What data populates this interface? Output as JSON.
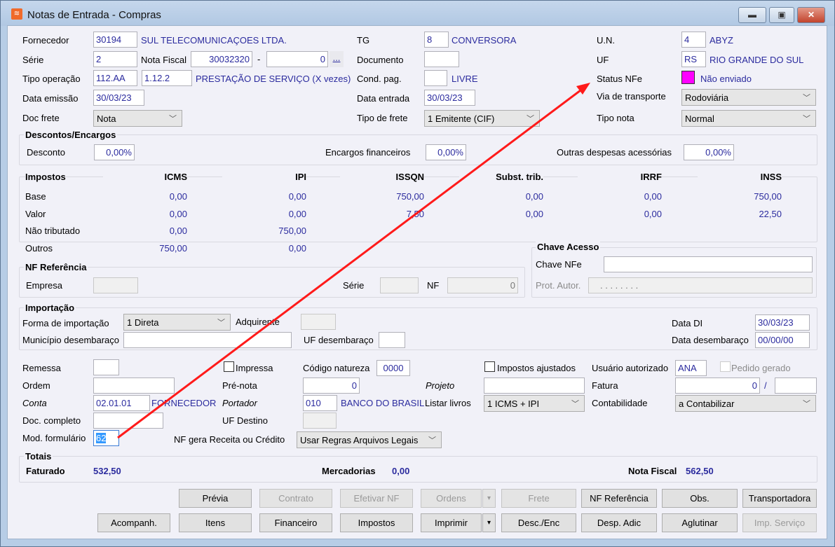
{
  "window": {
    "title": "Notas de Entrada - Compras",
    "minimize": "▬",
    "maximize": "▣",
    "close": "✕"
  },
  "header": {
    "fornecedor": {
      "label": "Fornecedor",
      "code": "30194",
      "name": "SUL TELECOMUNICAÇOES LTDA."
    },
    "serie": {
      "label": "Série",
      "value": "2"
    },
    "nota_fiscal": {
      "label": "Nota Fiscal",
      "value": "30032320",
      "dash": "-",
      "sub": "0",
      "more": "..."
    },
    "tipo_operacao": {
      "label": "Tipo operação",
      "code": "112.AA",
      "cfop": "1.12.2",
      "name": "PRESTAÇÃO DE SERVIÇO (X vezes)"
    },
    "data_emissao": {
      "label": "Data emissão",
      "value": "30/03/23"
    },
    "doc_frete": {
      "label": "Doc frete",
      "value": "Nota"
    },
    "tg": {
      "label": "TG",
      "code": "8",
      "name": "CONVERSORA"
    },
    "documento": {
      "label": "Documento",
      "value": ""
    },
    "cond_pag": {
      "label": "Cond. pag.",
      "code": "",
      "name": "LIVRE"
    },
    "data_entrada": {
      "label": "Data entrada",
      "value": "30/03/23"
    },
    "tipo_frete": {
      "label": "Tipo de frete",
      "value": "1 Emitente (CIF)"
    },
    "un": {
      "label": "U.N.",
      "code": "4",
      "name": "ABYZ"
    },
    "uf": {
      "label": "UF",
      "code": "RS",
      "name": "RIO GRANDE DO SUL"
    },
    "status_nfe": {
      "label": "Status NFe",
      "value": "Não enviado",
      "color": "#ff00ff"
    },
    "via_transporte": {
      "label": "Via de transporte",
      "value": "Rodoviária"
    },
    "tipo_nota": {
      "label": "Tipo nota",
      "value": "Normal"
    }
  },
  "descontos": {
    "title": "Descontos/Encargos",
    "desconto_label": "Desconto",
    "desconto": "0,00%",
    "encargos_label": "Encargos financeiros",
    "encargos": "0,00%",
    "outras_label": "Outras despesas acessórias",
    "outras": "0,00%"
  },
  "impostos": {
    "title": "Impostos",
    "columns": [
      "ICMS",
      "IPI",
      "ISSQN",
      "Subst. trib.",
      "IRRF",
      "INSS"
    ],
    "rows": [
      {
        "label": "Base",
        "values": [
          "0,00",
          "0,00",
          "750,00",
          "0,00",
          "0,00",
          "750,00"
        ]
      },
      {
        "label": "Valor",
        "values": [
          "0,00",
          "0,00",
          "7,50",
          "0,00",
          "0,00",
          "22,50"
        ]
      },
      {
        "label": "Não tributado",
        "values": [
          "0,00",
          "750,00"
        ]
      },
      {
        "label": "Outros",
        "values": [
          "750,00",
          "0,00"
        ]
      }
    ]
  },
  "chave": {
    "title": "Chave Acesso",
    "chave_label": "Chave NFe",
    "chave": "",
    "prot_label": "Prot. Autor.",
    "prot": ". . . . . . . ."
  },
  "nf_ref": {
    "title": "NF Referência",
    "empresa_label": "Empresa",
    "empresa": "",
    "serie_label": "Série",
    "serie": "",
    "nf_label": "NF",
    "nf": "0"
  },
  "importacao": {
    "title": "Importação",
    "forma_label": "Forma de importação",
    "forma": "1 Direta",
    "adquirente_label": "Adquirente",
    "adquirente": "",
    "municipio_label": "Município desembaraço",
    "municipio": "",
    "uf_label": "UF desembaraço",
    "uf": "",
    "data_di_label": "Data DI",
    "data_di": "30/03/23",
    "data_des_label": "Data desembaraço",
    "data_des": "00/00/00"
  },
  "lower": {
    "remessa_label": "Remessa",
    "remessa": "",
    "impressa_label": "Impressa",
    "codigo_label": "Código natureza",
    "codigo": "0000",
    "impostos_aj_label": "Impostos ajustados",
    "usuario_label": "Usuário autorizado",
    "usuario": "ANA",
    "pedido_label": "Pedido gerado",
    "ordem_label": "Ordem",
    "ordem": "",
    "prenota_label": "Pré-nota",
    "prenota": "0",
    "projeto_label": "Projeto",
    "projeto": "",
    "fatura_label": "Fatura",
    "fatura": "0",
    "slash": "/",
    "fatura2": "",
    "conta_label": "Conta",
    "conta": "02.01.01",
    "conta_name": "FORNECEDOR",
    "portador_label": "Portador",
    "portador": "010",
    "portador_name": "BANCO DO BRASIL",
    "listar_label": "Listar livros",
    "listar": "1 ICMS + IPI",
    "contab_label": "Contabilidade",
    "contab": "a Contabilizar",
    "doc_label": "Doc. completo",
    "doc": "",
    "ufdest_label": "UF Destino",
    "ufdest": "",
    "mod_label": "Mod. formulário",
    "mod": "62",
    "nfgera_label": "NF gera Receita ou Crédito",
    "nfgera": "Usar Regras Arquivos Legais"
  },
  "totais": {
    "title": "Totais",
    "faturado_label": "Faturado",
    "faturado": "532,50",
    "merc_label": "Mercadorias",
    "merc": "0,00",
    "nf_label": "Nota Fiscal",
    "nf": "562,50"
  },
  "buttons": {
    "previa": "Prévia",
    "contrato": "Contrato",
    "efetivar": "Efetivar NF",
    "ordens": "Ordens",
    "frete": "Frete",
    "nfref": "NF Referência",
    "obs": "Obs.",
    "transp": "Transportadora",
    "acomp": "Acompanh.",
    "itens": "Itens",
    "financeiro": "Financeiro",
    "impostos": "Impostos",
    "imprimir": "Imprimir",
    "desc": "Desc./Enc",
    "desp": "Desp. Adic",
    "aglutinar": "Aglutinar",
    "impserv": "Imp. Serviço",
    "dropdown": "▾"
  },
  "annotation": {
    "arrow_color": "#ff1a1a"
  }
}
